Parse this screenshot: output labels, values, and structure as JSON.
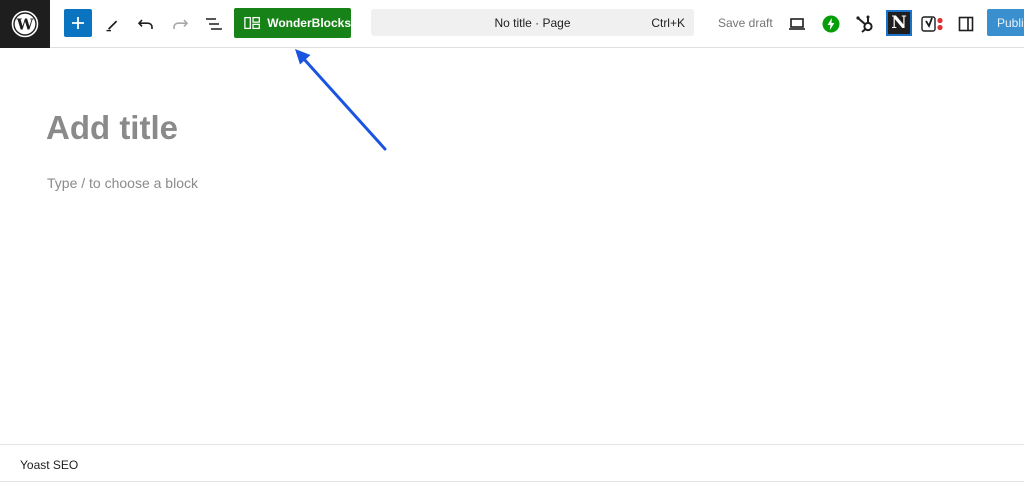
{
  "toolbar": {
    "logo_icon": "wordpress-logo-icon",
    "inserter_icon": "plus-icon",
    "tools_icon": "pencil-icon",
    "undo_icon": "undo-icon",
    "redo_icon": "redo-icon",
    "outline_icon": "list-view-icon",
    "wonderblocks_label": "WonderBlocks",
    "wonderblocks_color": "#178217",
    "command": {
      "title": "No title · Page",
      "shortcut": "Ctrl+K"
    },
    "save_draft_label": "Save draft",
    "preview_icon": "laptop-icon",
    "jetpack_icon": "jetpack-bolt-icon",
    "jetpack_color": "#069e08",
    "hubspot_icon": "hubspot-sprocket-icon",
    "n_plugin_label": "N",
    "yoast_icon": "yoast-icon",
    "settings_icon": "sidebar-panel-icon",
    "publish_label": "Publi",
    "accent_color": "#0a74c1"
  },
  "editor": {
    "title_placeholder": "Add title",
    "block_placeholder": "Type / to choose a block"
  },
  "annotation": {
    "arrow_color": "#1a54e0",
    "arrow_icon": "arrow-icon"
  },
  "metabox": {
    "title": "Yoast SEO"
  }
}
